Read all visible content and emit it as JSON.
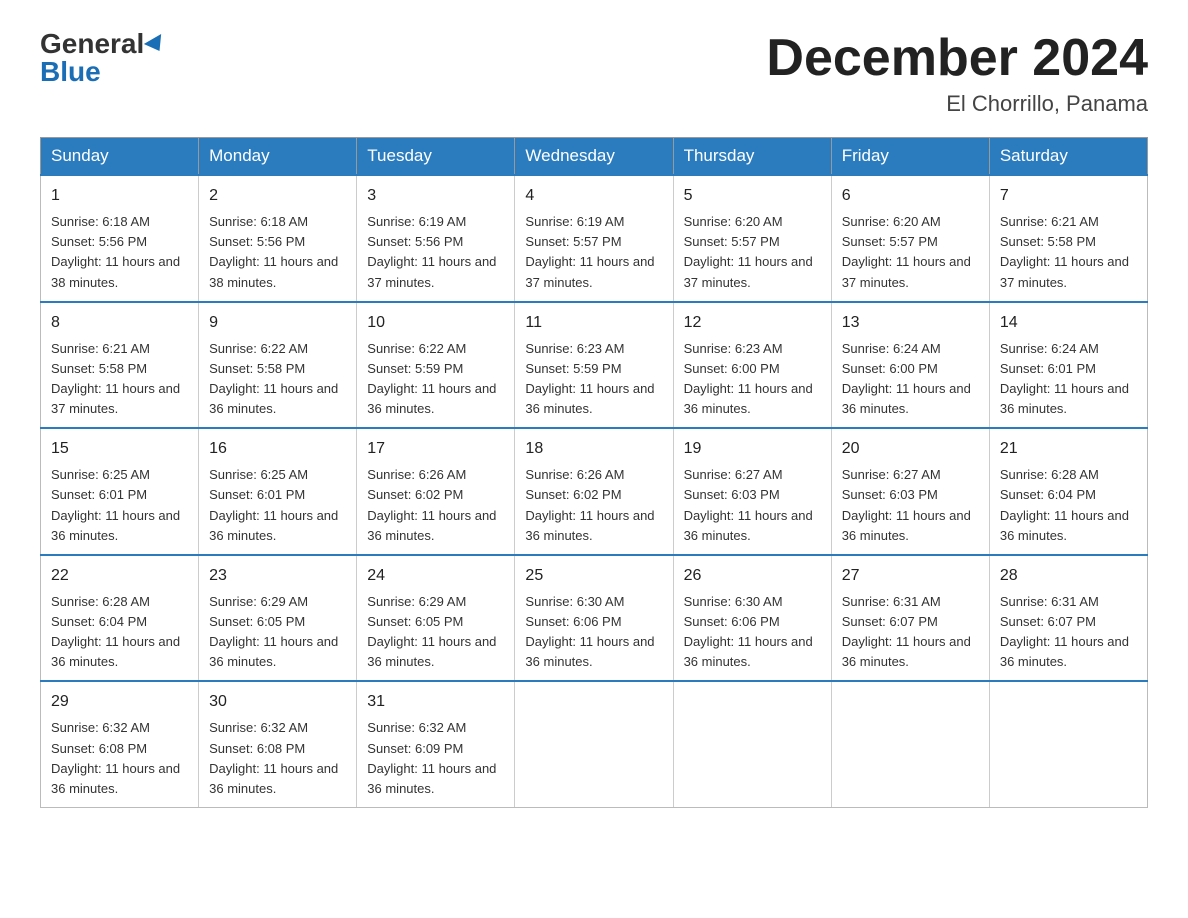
{
  "logo": {
    "general": "General",
    "blue": "Blue"
  },
  "header": {
    "month_year": "December 2024",
    "location": "El Chorrillo, Panama"
  },
  "days_of_week": [
    "Sunday",
    "Monday",
    "Tuesday",
    "Wednesday",
    "Thursday",
    "Friday",
    "Saturday"
  ],
  "weeks": [
    [
      {
        "day": "1",
        "sunrise": "6:18 AM",
        "sunset": "5:56 PM",
        "daylight": "11 hours and 38 minutes"
      },
      {
        "day": "2",
        "sunrise": "6:18 AM",
        "sunset": "5:56 PM",
        "daylight": "11 hours and 38 minutes"
      },
      {
        "day": "3",
        "sunrise": "6:19 AM",
        "sunset": "5:56 PM",
        "daylight": "11 hours and 37 minutes"
      },
      {
        "day": "4",
        "sunrise": "6:19 AM",
        "sunset": "5:57 PM",
        "daylight": "11 hours and 37 minutes"
      },
      {
        "day": "5",
        "sunrise": "6:20 AM",
        "sunset": "5:57 PM",
        "daylight": "11 hours and 37 minutes"
      },
      {
        "day": "6",
        "sunrise": "6:20 AM",
        "sunset": "5:57 PM",
        "daylight": "11 hours and 37 minutes"
      },
      {
        "day": "7",
        "sunrise": "6:21 AM",
        "sunset": "5:58 PM",
        "daylight": "11 hours and 37 minutes"
      }
    ],
    [
      {
        "day": "8",
        "sunrise": "6:21 AM",
        "sunset": "5:58 PM",
        "daylight": "11 hours and 37 minutes"
      },
      {
        "day": "9",
        "sunrise": "6:22 AM",
        "sunset": "5:58 PM",
        "daylight": "11 hours and 36 minutes"
      },
      {
        "day": "10",
        "sunrise": "6:22 AM",
        "sunset": "5:59 PM",
        "daylight": "11 hours and 36 minutes"
      },
      {
        "day": "11",
        "sunrise": "6:23 AM",
        "sunset": "5:59 PM",
        "daylight": "11 hours and 36 minutes"
      },
      {
        "day": "12",
        "sunrise": "6:23 AM",
        "sunset": "6:00 PM",
        "daylight": "11 hours and 36 minutes"
      },
      {
        "day": "13",
        "sunrise": "6:24 AM",
        "sunset": "6:00 PM",
        "daylight": "11 hours and 36 minutes"
      },
      {
        "day": "14",
        "sunrise": "6:24 AM",
        "sunset": "6:01 PM",
        "daylight": "11 hours and 36 minutes"
      }
    ],
    [
      {
        "day": "15",
        "sunrise": "6:25 AM",
        "sunset": "6:01 PM",
        "daylight": "11 hours and 36 minutes"
      },
      {
        "day": "16",
        "sunrise": "6:25 AM",
        "sunset": "6:01 PM",
        "daylight": "11 hours and 36 minutes"
      },
      {
        "day": "17",
        "sunrise": "6:26 AM",
        "sunset": "6:02 PM",
        "daylight": "11 hours and 36 minutes"
      },
      {
        "day": "18",
        "sunrise": "6:26 AM",
        "sunset": "6:02 PM",
        "daylight": "11 hours and 36 minutes"
      },
      {
        "day": "19",
        "sunrise": "6:27 AM",
        "sunset": "6:03 PM",
        "daylight": "11 hours and 36 minutes"
      },
      {
        "day": "20",
        "sunrise": "6:27 AM",
        "sunset": "6:03 PM",
        "daylight": "11 hours and 36 minutes"
      },
      {
        "day": "21",
        "sunrise": "6:28 AM",
        "sunset": "6:04 PM",
        "daylight": "11 hours and 36 minutes"
      }
    ],
    [
      {
        "day": "22",
        "sunrise": "6:28 AM",
        "sunset": "6:04 PM",
        "daylight": "11 hours and 36 minutes"
      },
      {
        "day": "23",
        "sunrise": "6:29 AM",
        "sunset": "6:05 PM",
        "daylight": "11 hours and 36 minutes"
      },
      {
        "day": "24",
        "sunrise": "6:29 AM",
        "sunset": "6:05 PM",
        "daylight": "11 hours and 36 minutes"
      },
      {
        "day": "25",
        "sunrise": "6:30 AM",
        "sunset": "6:06 PM",
        "daylight": "11 hours and 36 minutes"
      },
      {
        "day": "26",
        "sunrise": "6:30 AM",
        "sunset": "6:06 PM",
        "daylight": "11 hours and 36 minutes"
      },
      {
        "day": "27",
        "sunrise": "6:31 AM",
        "sunset": "6:07 PM",
        "daylight": "11 hours and 36 minutes"
      },
      {
        "day": "28",
        "sunrise": "6:31 AM",
        "sunset": "6:07 PM",
        "daylight": "11 hours and 36 minutes"
      }
    ],
    [
      {
        "day": "29",
        "sunrise": "6:32 AM",
        "sunset": "6:08 PM",
        "daylight": "11 hours and 36 minutes"
      },
      {
        "day": "30",
        "sunrise": "6:32 AM",
        "sunset": "6:08 PM",
        "daylight": "11 hours and 36 minutes"
      },
      {
        "day": "31",
        "sunrise": "6:32 AM",
        "sunset": "6:09 PM",
        "daylight": "11 hours and 36 minutes"
      },
      null,
      null,
      null,
      null
    ]
  ],
  "labels": {
    "sunrise": "Sunrise:",
    "sunset": "Sunset:",
    "daylight": "Daylight:"
  }
}
